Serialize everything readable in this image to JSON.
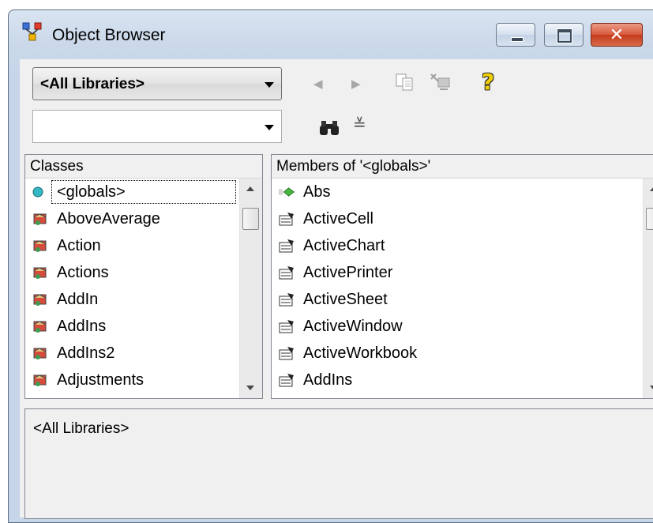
{
  "window": {
    "title": "Object Browser"
  },
  "toolbar": {
    "library_combo_value": "<All Libraries>",
    "search_value": "",
    "icons": [
      "back-icon",
      "forward-icon",
      "copy-icon",
      "view-definition-icon",
      "help-icon",
      "find-icon",
      "expand-results-icon"
    ]
  },
  "classes": {
    "header": "Classes",
    "items": [
      {
        "label": "<globals>",
        "icon": "globals-icon"
      },
      {
        "label": "AboveAverage",
        "icon": "class-icon"
      },
      {
        "label": "Action",
        "icon": "class-icon"
      },
      {
        "label": "Actions",
        "icon": "class-icon"
      },
      {
        "label": "AddIn",
        "icon": "class-icon"
      },
      {
        "label": "AddIns",
        "icon": "class-icon"
      },
      {
        "label": "AddIns2",
        "icon": "class-icon"
      },
      {
        "label": "Adjustments",
        "icon": "class-icon"
      }
    ],
    "selected_index": 0
  },
  "members": {
    "header": "Members of '<globals>'",
    "items": [
      {
        "label": "Abs",
        "icon": "method-icon"
      },
      {
        "label": "ActiveCell",
        "icon": "property-icon"
      },
      {
        "label": "ActiveChart",
        "icon": "property-icon"
      },
      {
        "label": "ActivePrinter",
        "icon": "property-icon"
      },
      {
        "label": "ActiveSheet",
        "icon": "property-icon"
      },
      {
        "label": "ActiveWindow",
        "icon": "property-icon"
      },
      {
        "label": "ActiveWorkbook",
        "icon": "property-icon"
      },
      {
        "label": "AddIns",
        "icon": "property-icon"
      }
    ]
  },
  "details": {
    "text": "<All Libraries>"
  }
}
